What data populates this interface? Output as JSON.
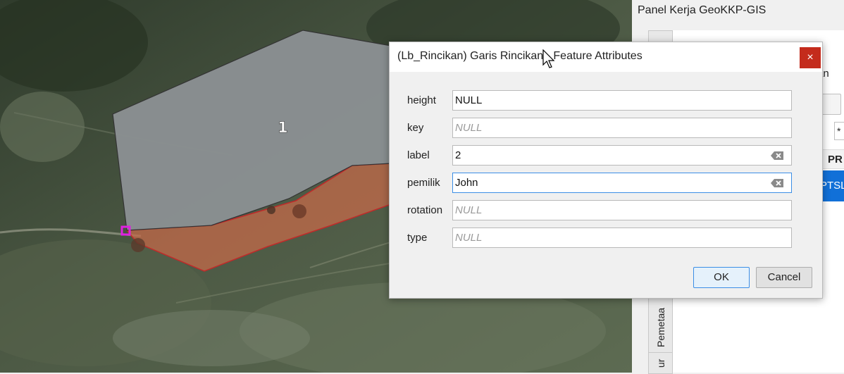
{
  "map": {
    "polygon_labels": [
      "1"
    ]
  },
  "panel": {
    "title": "Panel Kerja GeoKKP-GIS",
    "tab_fragment": "an",
    "vertical_tabs": [
      "Pemetaa",
      "ur"
    ],
    "star_fragment": "*",
    "column_header_fragment": "PR",
    "selected_row_fragment": "PTSL",
    "selected_row_color": "#1170d8"
  },
  "dialog": {
    "title": "(Lb_Rincikan) Garis Rincikan - Feature Attributes",
    "close_label": "×",
    "fields": [
      {
        "label": "height",
        "value": "NULL",
        "is_null": false
      },
      {
        "label": "key",
        "value": "NULL",
        "is_null": true
      },
      {
        "label": "label",
        "value": "2",
        "is_null": false
      },
      {
        "label": "pemilik",
        "value": "John",
        "is_null": false
      },
      {
        "label": "rotation",
        "value": "NULL",
        "is_null": true
      },
      {
        "label": "type",
        "value": "NULL",
        "is_null": true
      }
    ],
    "ok_label": "OK",
    "cancel_label": "Cancel",
    "close_color": "#c42b1c"
  }
}
